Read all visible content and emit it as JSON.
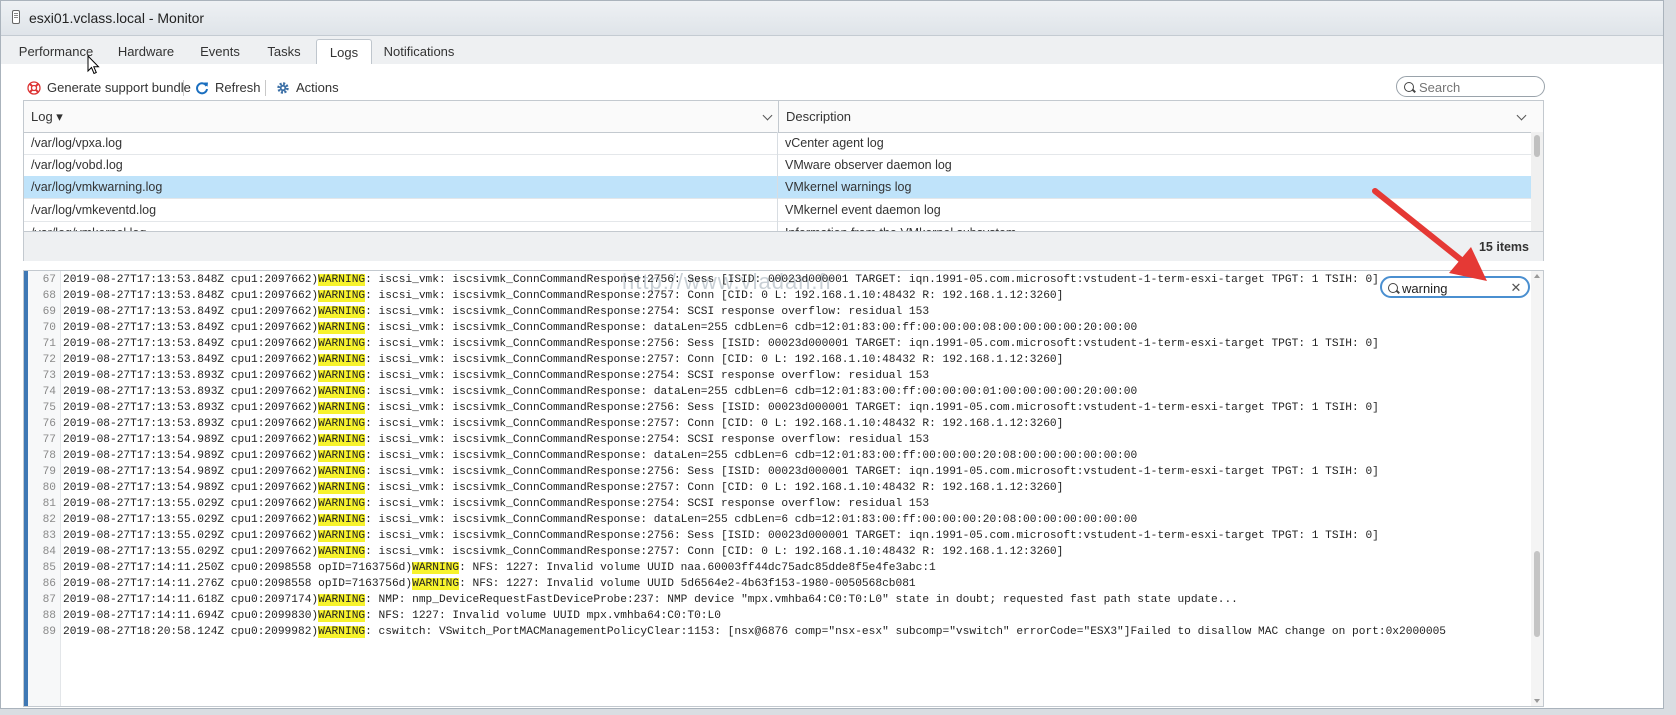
{
  "window": {
    "title": "esxi01.vclass.local - Monitor"
  },
  "tabs": [
    {
      "label": "Performance"
    },
    {
      "label": "Hardware"
    },
    {
      "label": "Events"
    },
    {
      "label": "Tasks"
    },
    {
      "label": "Logs",
      "active": true
    },
    {
      "label": "Notifications"
    }
  ],
  "toolbar": {
    "generate_label": "Generate support bundle",
    "refresh_label": "Refresh",
    "actions_label": "Actions",
    "search_placeholder": "Search"
  },
  "grid": {
    "col_log": "Log ▾",
    "col_description": "Description",
    "rows": [
      {
        "log": "/var/log/vpxa.log",
        "description": "vCenter agent log"
      },
      {
        "log": "/var/log/vobd.log",
        "description": "VMware observer daemon log"
      },
      {
        "log": "/var/log/vmkwarning.log",
        "description": "VMkernel warnings log",
        "selected": true
      },
      {
        "log": "/var/log/vmkeventd.log",
        "description": "VMkernel event daemon log"
      },
      {
        "log": "/var/log/vmkernel.log",
        "description": "Information from the VMkernel subsystem"
      }
    ],
    "items_count": "15 items"
  },
  "logview": {
    "filter_value": "warning",
    "watermark": "http://www.vladan.fr",
    "lines": [
      {
        "n": "67",
        "pre": "2019-08-27T17:13:53.848Z cpu1:2097662)",
        "hl": "WARNING",
        "post": ": iscsi_vmk: iscsivmk_ConnCommandResponse:2756: Sess [ISID: 00023d000001 TARGET: iqn.1991-05.com.microsoft:vstudent-1-term-esxi-target TPGT: 1 TSIH: 0]"
      },
      {
        "n": "68",
        "pre": "2019-08-27T17:13:53.848Z cpu1:2097662)",
        "hl": "WARNING",
        "post": ": iscsi_vmk: iscsivmk_ConnCommandResponse:2757: Conn [CID: 0 L: 192.168.1.10:48432 R: 192.168.1.12:3260]"
      },
      {
        "n": "69",
        "pre": "2019-08-27T17:13:53.849Z cpu1:2097662)",
        "hl": "WARNING",
        "post": ": iscsi_vmk: iscsivmk_ConnCommandResponse:2754: SCSI response overflow: residual 153"
      },
      {
        "n": "70",
        "pre": "2019-08-27T17:13:53.849Z cpu1:2097662)",
        "hl": "WARNING",
        "post": ": iscsi_vmk: iscsivmk_ConnCommandResponse: dataLen=255 cdbLen=6 cdb=12:01:83:00:ff:00:00:00:08:00:00:00:00:20:00:00"
      },
      {
        "n": "71",
        "pre": "2019-08-27T17:13:53.849Z cpu1:2097662)",
        "hl": "WARNING",
        "post": ": iscsi_vmk: iscsivmk_ConnCommandResponse:2756: Sess [ISID: 00023d000001 TARGET: iqn.1991-05.com.microsoft:vstudent-1-term-esxi-target TPGT: 1 TSIH: 0]"
      },
      {
        "n": "72",
        "pre": "2019-08-27T17:13:53.849Z cpu1:2097662)",
        "hl": "WARNING",
        "post": ": iscsi_vmk: iscsivmk_ConnCommandResponse:2757: Conn [CID: 0 L: 192.168.1.10:48432 R: 192.168.1.12:3260]"
      },
      {
        "n": "73",
        "pre": "2019-08-27T17:13:53.893Z cpu1:2097662)",
        "hl": "WARNING",
        "post": ": iscsi_vmk: iscsivmk_ConnCommandResponse:2754: SCSI response overflow: residual 153"
      },
      {
        "n": "74",
        "pre": "2019-08-27T17:13:53.893Z cpu1:2097662)",
        "hl": "WARNING",
        "post": ": iscsi_vmk: iscsivmk_ConnCommandResponse: dataLen=255 cdbLen=6 cdb=12:01:83:00:ff:00:00:00:01:00:00:00:00:20:00:00"
      },
      {
        "n": "75",
        "pre": "2019-08-27T17:13:53.893Z cpu1:2097662)",
        "hl": "WARNING",
        "post": ": iscsi_vmk: iscsivmk_ConnCommandResponse:2756: Sess [ISID: 00023d000001 TARGET: iqn.1991-05.com.microsoft:vstudent-1-term-esxi-target TPGT: 1 TSIH: 0]"
      },
      {
        "n": "76",
        "pre": "2019-08-27T17:13:53.893Z cpu1:2097662)",
        "hl": "WARNING",
        "post": ": iscsi_vmk: iscsivmk_ConnCommandResponse:2757: Conn [CID: 0 L: 192.168.1.10:48432 R: 192.168.1.12:3260]"
      },
      {
        "n": "77",
        "pre": "2019-08-27T17:13:54.989Z cpu1:2097662)",
        "hl": "WARNING",
        "post": ": iscsi_vmk: iscsivmk_ConnCommandResponse:2754: SCSI response overflow: residual 153"
      },
      {
        "n": "78",
        "pre": "2019-08-27T17:13:54.989Z cpu1:2097662)",
        "hl": "WARNING",
        "post": ": iscsi_vmk: iscsivmk_ConnCommandResponse: dataLen=255 cdbLen=6 cdb=12:01:83:00:ff:00:00:00:20:08:00:00:00:00:00:00"
      },
      {
        "n": "79",
        "pre": "2019-08-27T17:13:54.989Z cpu1:2097662)",
        "hl": "WARNING",
        "post": ": iscsi_vmk: iscsivmk_ConnCommandResponse:2756: Sess [ISID: 00023d000001 TARGET: iqn.1991-05.com.microsoft:vstudent-1-term-esxi-target TPGT: 1 TSIH: 0]"
      },
      {
        "n": "80",
        "pre": "2019-08-27T17:13:54.989Z cpu1:2097662)",
        "hl": "WARNING",
        "post": ": iscsi_vmk: iscsivmk_ConnCommandResponse:2757: Conn [CID: 0 L: 192.168.1.10:48432 R: 192.168.1.12:3260]"
      },
      {
        "n": "81",
        "pre": "2019-08-27T17:13:55.029Z cpu1:2097662)",
        "hl": "WARNING",
        "post": ": iscsi_vmk: iscsivmk_ConnCommandResponse:2754: SCSI response overflow: residual 153"
      },
      {
        "n": "82",
        "pre": "2019-08-27T17:13:55.029Z cpu1:2097662)",
        "hl": "WARNING",
        "post": ": iscsi_vmk: iscsivmk_ConnCommandResponse: dataLen=255 cdbLen=6 cdb=12:01:83:00:ff:00:00:00:20:08:00:00:00:00:00:00"
      },
      {
        "n": "83",
        "pre": "2019-08-27T17:13:55.029Z cpu1:2097662)",
        "hl": "WARNING",
        "post": ": iscsi_vmk: iscsivmk_ConnCommandResponse:2756: Sess [ISID: 00023d000001 TARGET: iqn.1991-05.com.microsoft:vstudent-1-term-esxi-target TPGT: 1 TSIH: 0]"
      },
      {
        "n": "84",
        "pre": "2019-08-27T17:13:55.029Z cpu1:2097662)",
        "hl": "WARNING",
        "post": ": iscsi_vmk: iscsivmk_ConnCommandResponse:2757: Conn [CID: 0 L: 192.168.1.10:48432 R: 192.168.1.12:3260]"
      },
      {
        "n": "85",
        "pre": "2019-08-27T17:14:11.250Z cpu0:2098558 opID=7163756d)",
        "hl": "WARNING",
        "post": ": NFS: 1227: Invalid volume UUID naa.60003ff44dc75adc85dde8f5e4fe3abc:1"
      },
      {
        "n": "86",
        "pre": "2019-08-27T17:14:11.276Z cpu0:2098558 opID=7163756d)",
        "hl": "WARNING",
        "post": ": NFS: 1227: Invalid volume UUID 5d6564e2-4b63f153-1980-0050568cb081"
      },
      {
        "n": "87",
        "pre": "2019-08-27T17:14:11.618Z cpu0:2097174)",
        "hl": "WARNING",
        "post": ": NMP: nmp_DeviceRequestFastDeviceProbe:237: NMP device \"mpx.vmhba64:C0:T0:L0\" state in doubt; requested fast path state update..."
      },
      {
        "n": "88",
        "pre": "2019-08-27T17:14:11.694Z cpu0:2099830)",
        "hl": "WARNING",
        "post": ": NFS: 1227: Invalid volume UUID mpx.vmhba64:C0:T0:L0"
      },
      {
        "n": "89",
        "pre": "2019-08-27T18:20:58.124Z cpu0:2099982)",
        "hl": "WARNING",
        "post": ": cswitch: VSwitch_PortMACManagementPolicyClear:1153: [nsx@6876 comp=\"nsx-esx\" subcomp=\"vswitch\" errorCode=\"ESX3\"]Failed to disallow MAC change on port:0x2000005"
      }
    ]
  },
  "colors": {
    "accent": "#3f78b4",
    "selection": "#bfe3fa",
    "highlight": "#f7f32d",
    "arrow": "#e53935"
  }
}
